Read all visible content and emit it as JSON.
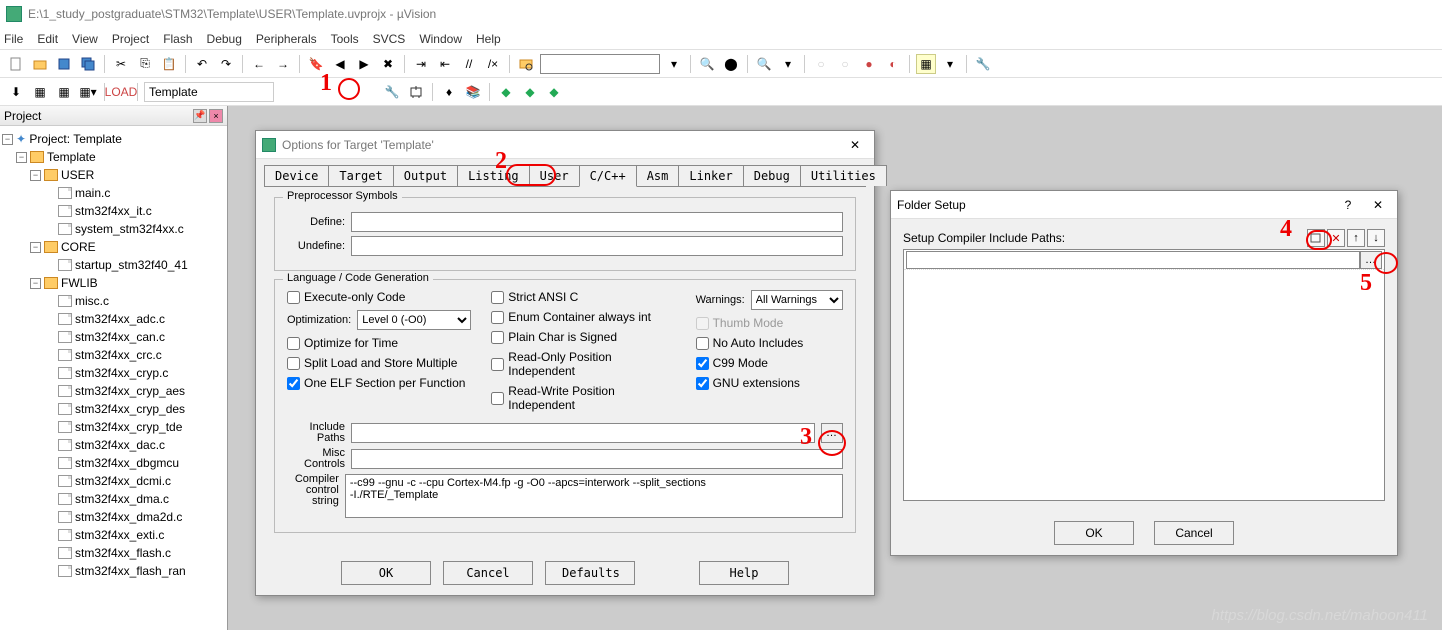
{
  "app": {
    "title": "E:\\1_study_postgraduate\\STM32\\Template\\USER\\Template.uvprojx - µVision",
    "menu": [
      "File",
      "Edit",
      "View",
      "Project",
      "Flash",
      "Debug",
      "Peripherals",
      "Tools",
      "SVCS",
      "Window",
      "Help"
    ],
    "target": "Template"
  },
  "project_panel": {
    "title": "Project",
    "root": "Project: Template",
    "groups": [
      {
        "name": "Template",
        "children": [
          {
            "name": "USER",
            "files": [
              "main.c",
              "stm32f4xx_it.c",
              "system_stm32f4xx.c"
            ]
          },
          {
            "name": "CORE",
            "files": [
              "startup_stm32f40_41"
            ]
          },
          {
            "name": "FWLIB",
            "files": [
              "misc.c",
              "stm32f4xx_adc.c",
              "stm32f4xx_can.c",
              "stm32f4xx_crc.c",
              "stm32f4xx_cryp.c",
              "stm32f4xx_cryp_aes",
              "stm32f4xx_cryp_des",
              "stm32f4xx_cryp_tde",
              "stm32f4xx_dac.c",
              "stm32f4xx_dbgmcu",
              "stm32f4xx_dcmi.c",
              "stm32f4xx_dma.c",
              "stm32f4xx_dma2d.c",
              "stm32f4xx_exti.c",
              "stm32f4xx_flash.c",
              "stm32f4xx_flash_ran"
            ]
          }
        ]
      }
    ]
  },
  "options_dialog": {
    "title": "Options for Target 'Template'",
    "tabs": [
      "Device",
      "Target",
      "Output",
      "Listing",
      "User",
      "C/C++",
      "Asm",
      "Linker",
      "Debug",
      "Utilities"
    ],
    "active_tab": "C/C++",
    "preproc": {
      "legend": "Preprocessor Symbols",
      "define_label": "Define:",
      "undefine_label": "Undefine:",
      "define": "",
      "undefine": ""
    },
    "lang": {
      "legend": "Language / Code Generation",
      "execute_only": "Execute-only Code",
      "optimization_label": "Optimization:",
      "optimization": "Level 0 (-O0)",
      "optimize_time": "Optimize for Time",
      "split_load": "Split Load and Store Multiple",
      "one_elf": "One ELF Section per Function",
      "strict_ansi": "Strict ANSI C",
      "enum_int": "Enum Container always int",
      "plain_char": "Plain Char is Signed",
      "readonly_pi": "Read-Only Position Independent",
      "readwrite_pi": "Read-Write Position Independent",
      "warnings_label": "Warnings:",
      "warnings": "All Warnings",
      "thumb": "Thumb Mode",
      "no_auto": "No Auto Includes",
      "c99": "C99 Mode",
      "gnu": "GNU extensions"
    },
    "include_label": "Include\nPaths",
    "misc_label": "Misc\nControls",
    "compiler_label": "Compiler\ncontrol\nstring",
    "compiler_string": "--c99 --gnu -c --cpu Cortex-M4.fp -g -O0 --apcs=interwork --split_sections\n-I./RTE/_Template",
    "buttons": {
      "ok": "OK",
      "cancel": "Cancel",
      "defaults": "Defaults",
      "help": "Help"
    }
  },
  "folder_dialog": {
    "title": "Folder Setup",
    "label": "Setup Compiler Include Paths:",
    "ok": "OK",
    "cancel": "Cancel"
  },
  "watermark": "https://blog.csdn.net/mahoon411",
  "anno": {
    "n1": "1",
    "n2": "2",
    "n3": "3",
    "n4": "4",
    "n5": "5"
  }
}
